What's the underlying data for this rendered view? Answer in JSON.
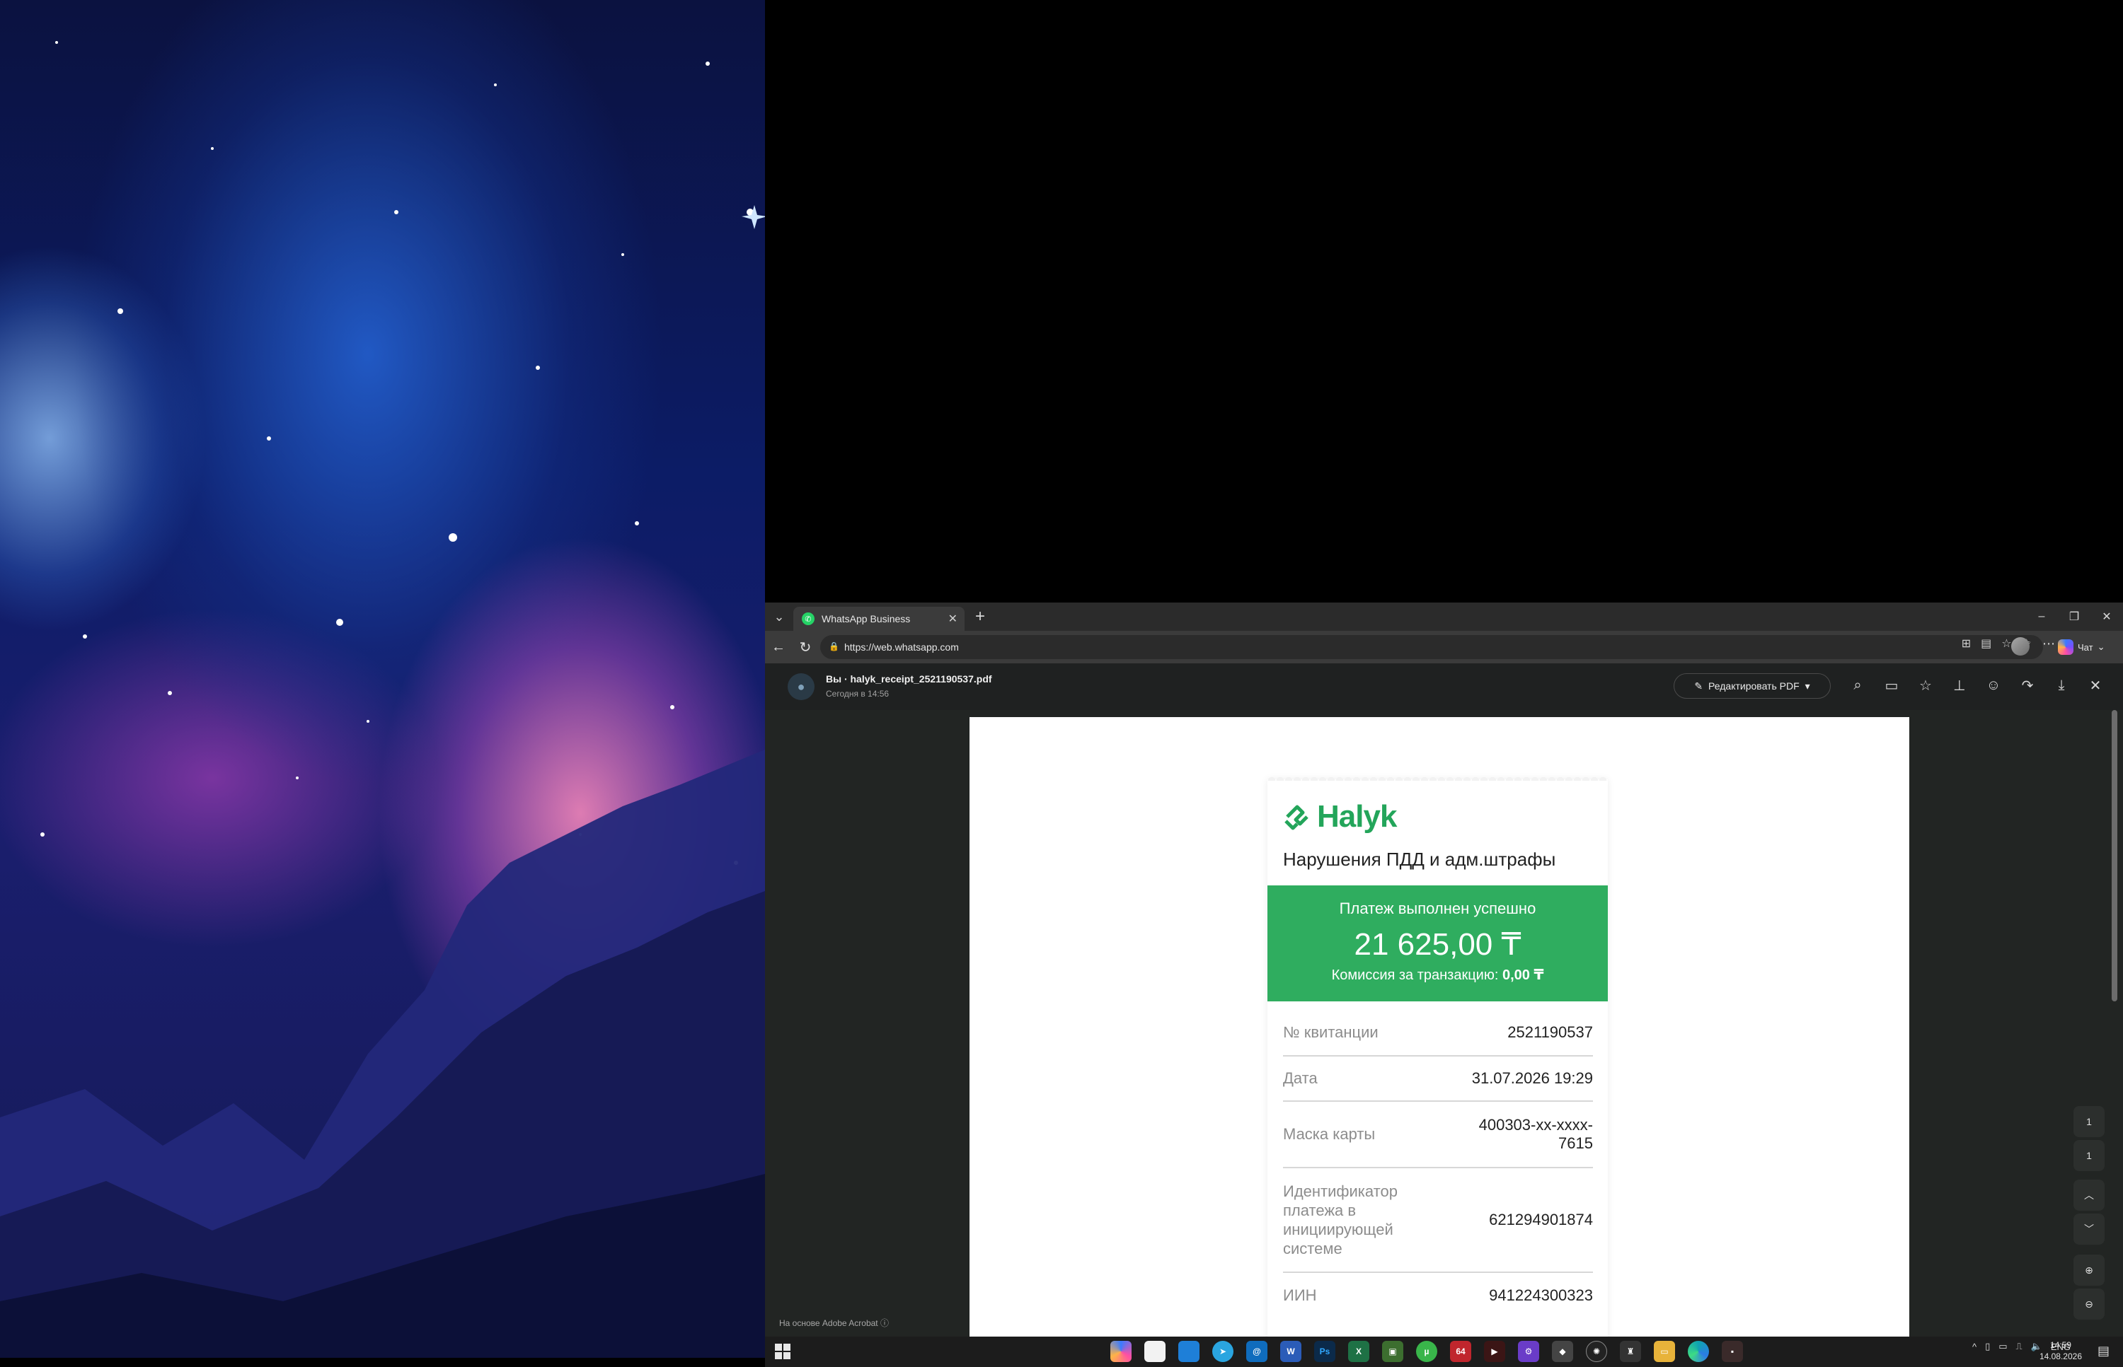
{
  "browser": {
    "tab_title": "WhatsApp Business",
    "url": "https://web.whatsapp.com",
    "copilot_label": "Чат"
  },
  "viewer": {
    "file_title": "Вы · halyk_receipt_2521190537.pdf",
    "file_subtitle": "Сегодня в 14:56",
    "edit_pdf_label": "Редактировать PDF",
    "acrobat_note": "На основе Adobe Acrobat",
    "page_current": "1",
    "page_total": "1"
  },
  "receipt": {
    "brand": "Halyk",
    "title": "Нарушения ПДД и адм.штрафы",
    "status": "Платеж выполнен успешно",
    "amount": "21 625,00 ₸",
    "fee_label": "Комиссия за транзакцию:",
    "fee_value": "0,00 ₸",
    "rows": [
      {
        "label": "№ квитанции",
        "value": "2521190537"
      },
      {
        "label": "Дата",
        "value": "31.07.2026 19:29"
      },
      {
        "label": "Маска карты",
        "value": "400303-xx-xxxx-7615"
      },
      {
        "label": "Идентификатор платежа в инициирующей системе",
        "value": "621294901874"
      },
      {
        "label": "ИИН",
        "value": "941224300323"
      }
    ]
  },
  "taskbar": {
    "lang": "ENG",
    "time": "14:59",
    "date": "14.08.2026",
    "badge_64": "64"
  },
  "colors": {
    "accent_green": "#2fad5f",
    "brand_green": "#23a55a"
  }
}
